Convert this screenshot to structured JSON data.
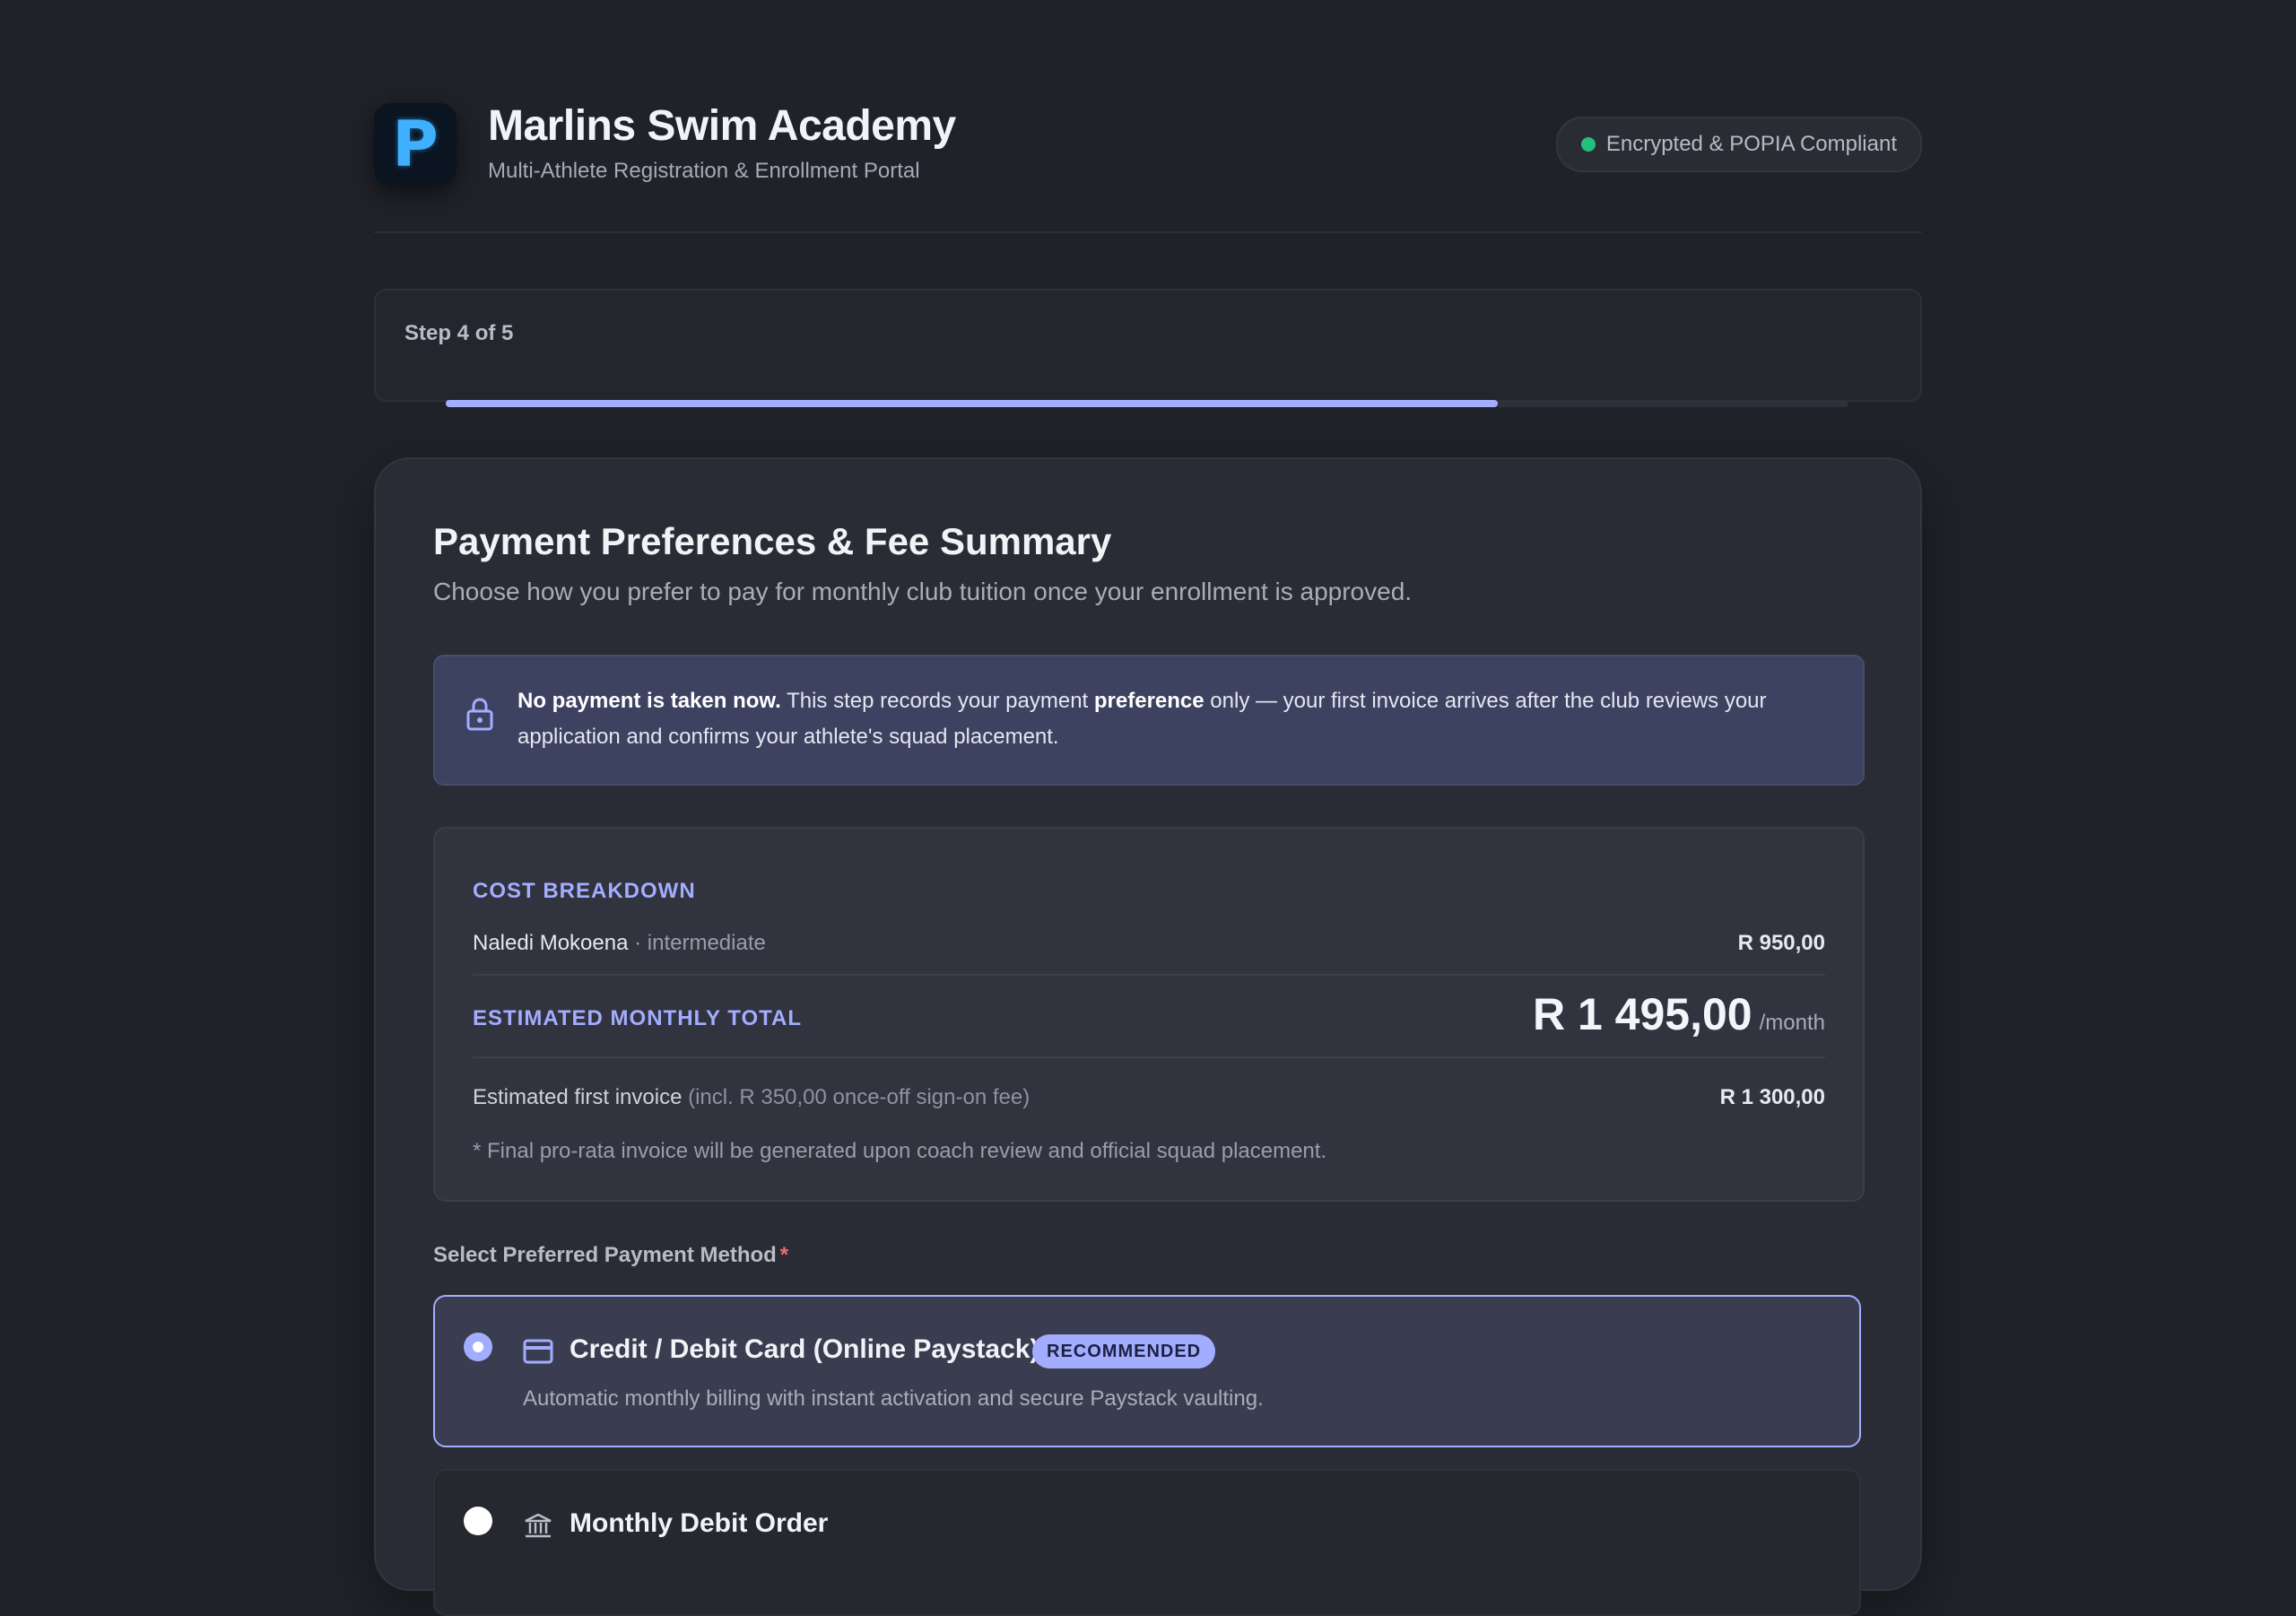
{
  "header": {
    "logo_letter": "P",
    "title": "Marlins Swim Academy",
    "subtitle": "Multi-Athlete Registration & Enrollment Portal",
    "security_badge": "Encrypted & POPIA Compliant"
  },
  "progress": {
    "step_label": "Step 4 of 5",
    "fraction": 0.75
  },
  "section": {
    "title": "Payment Preferences & Fee Summary",
    "description": "Choose how you prefer to pay for monthly club tuition once your enrollment is approved."
  },
  "notice": {
    "bold_lead": "No payment is taken now.",
    "text_1": " This step records your payment ",
    "bold_mid": "preference",
    "text_2": " only — your first invoice arrives after the club reviews your application and confirms your athlete's squad placement."
  },
  "cost_breakdown": {
    "heading": "COST BREAKDOWN",
    "athletes": [
      {
        "name": "Naledi Mokoena",
        "level": " · intermediate",
        "amount": "R 950,00"
      }
    ],
    "total_label": "ESTIMATED MONTHLY TOTAL",
    "total_amount": "R 1 495,00",
    "total_period": "/month",
    "first_invoice_label": "Estimated first invoice",
    "first_invoice_note": " (incl. R 350,00 once-off sign-on fee)",
    "first_invoice_amount": "R 1 300,00",
    "footnote": "* Final pro-rata invoice will be generated upon coach review and official squad placement."
  },
  "payment_methods": {
    "label": "Select Preferred Payment Method",
    "required_mark": "*",
    "options": [
      {
        "icon": "credit-card-icon",
        "title": "Credit / Debit Card (Online Paystack)",
        "badge": "RECOMMENDED",
        "description": "Automatic monthly billing with instant activation and secure Paystack vaulting.",
        "selected": true
      },
      {
        "icon": "bank-icon",
        "title": "Monthly Debit Order",
        "selected": false
      }
    ]
  },
  "colors": {
    "accent": "#a3adff",
    "success": "#22c07d",
    "background": "#202229",
    "card": "#2a2c35"
  }
}
